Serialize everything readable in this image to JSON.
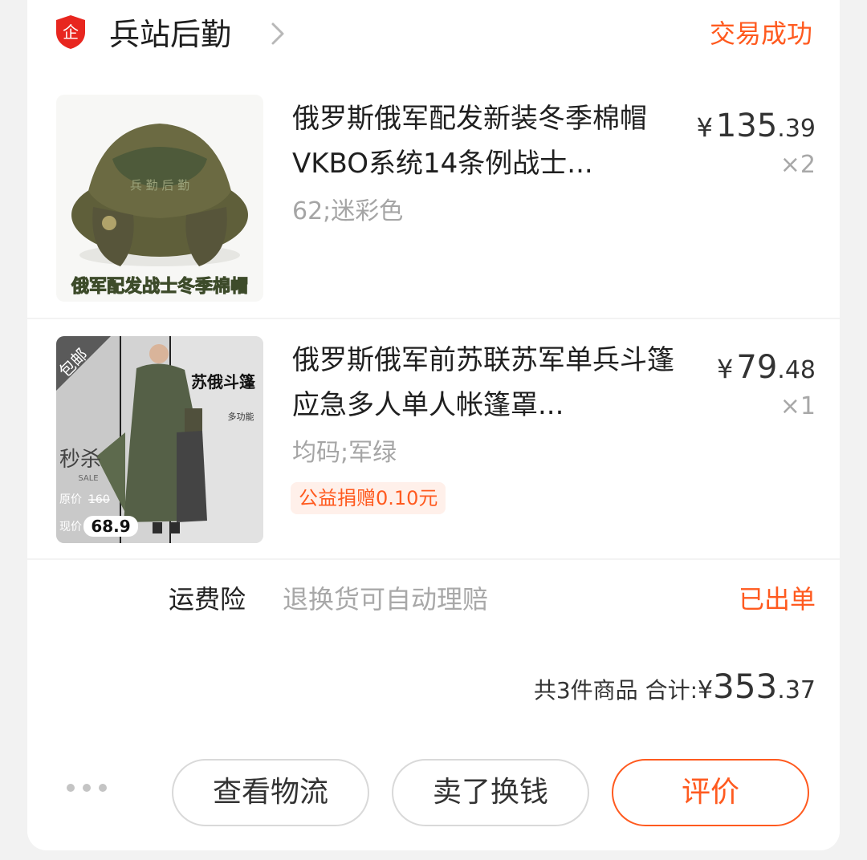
{
  "shop": {
    "name": "兵站后勤",
    "logo_glyph": "企",
    "status": "交易成功"
  },
  "items": [
    {
      "title": "俄罗斯俄军配发新装冬季棉帽VKBO系统14条例战士...",
      "spec": "62;迷彩色",
      "price_yen": "¥",
      "price_int": "135",
      "price_dec": ".39",
      "qty": "×2",
      "thumb_caption": "俄军配发战士冬季棉帽",
      "thumb_watermark": "兵 勤 后 勤"
    },
    {
      "title": "俄罗斯俄军前苏联苏军单兵斗篷应急多人单人帐篷罩...",
      "spec": "均码;军绿",
      "price_yen": "¥",
      "price_int": "79",
      "price_dec": ".48",
      "qty": "×1",
      "charity": "公益捐赠0.10元",
      "thumb_ribbon": "包邮",
      "thumb_heading": "苏俄斗篷",
      "thumb_sub": "多功能",
      "thumb_sale": "秒杀",
      "thumb_sale_en": "SALE",
      "thumb_orig_label": "原价",
      "thumb_orig_price": "160",
      "thumb_now_label": "现价",
      "thumb_now_price": "68.9"
    }
  ],
  "insurance": {
    "label": "运费险",
    "desc": "退换货可自动理赔",
    "status": "已出单"
  },
  "summary": {
    "count_text": "共3件商品",
    "total_label": "合计:",
    "yen": "¥",
    "int": "353",
    "dec": ".37"
  },
  "actions": {
    "logistics": "查看物流",
    "resell": "卖了换钱",
    "review": "评价"
  },
  "colors": {
    "accent": "#ff5a1f",
    "logo_red": "#e8261f",
    "muted": "#a8a8a8"
  }
}
